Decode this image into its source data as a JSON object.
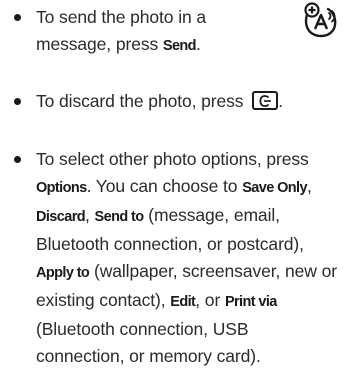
{
  "items": [
    {
      "lines": [
        [
          {
            "t": "To send the photo in a"
          }
        ],
        [
          {
            "t": "message, press "
          },
          {
            "t": "Send",
            "k": "cond"
          },
          {
            "t": "."
          }
        ]
      ]
    },
    {
      "lines": [
        [
          {
            "t": "To discard the photo, press "
          },
          {
            "k": "key",
            "icon": "clear-key-icon"
          },
          {
            "t": "."
          }
        ]
      ]
    },
    {
      "lines": [
        [
          {
            "t": "To select other photo options, press"
          }
        ],
        [
          {
            "t": "Options",
            "k": "cond"
          },
          {
            "t": ". You can choose to "
          },
          {
            "t": "Save Only",
            "k": "cond"
          },
          {
            "t": ","
          }
        ],
        [
          {
            "t": "Discard",
            "k": "cond"
          },
          {
            "t": ", "
          },
          {
            "t": "Send to",
            "k": "cond"
          },
          {
            "t": " (message, email,"
          }
        ],
        [
          {
            "t": "Bluetooth connection, or postcard),"
          }
        ],
        [
          {
            "t": "Apply to",
            "k": "cond"
          },
          {
            "t": " (wallpaper, screensaver, new or"
          }
        ],
        [
          {
            "t": "existing contact), "
          },
          {
            "t": "Edit",
            "k": "cond"
          },
          {
            "t": ", or "
          },
          {
            "t": "Print via",
            "k": "cond"
          }
        ],
        [
          {
            "t": "(Bluetooth connection, USB"
          }
        ],
        [
          {
            "t": "connection, or memory card)."
          }
        ]
      ]
    }
  ],
  "badge_icon": "accessibility-feature-icon"
}
